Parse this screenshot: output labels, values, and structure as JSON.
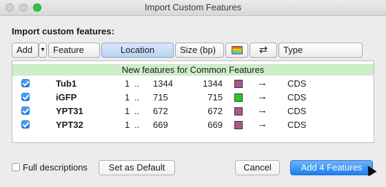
{
  "window": {
    "title": "Import Custom Features"
  },
  "section_label": "Import custom features:",
  "columns": {
    "add": "Add",
    "add_menu": "▾",
    "feature": "Feature",
    "location": "Location",
    "size": "Size (bp)",
    "direction": "⇄",
    "type": "Type"
  },
  "group_header": "New features for Common Features",
  "rows": [
    {
      "checked": true,
      "name": "Tub1",
      "start": "1",
      "dots": "..",
      "end": "1344",
      "size": "1344",
      "color": "#b0578a",
      "direction": "→",
      "type": "CDS"
    },
    {
      "checked": true,
      "name": "iGFP",
      "start": "1",
      "dots": "..",
      "end": "715",
      "size": "715",
      "color": "#22cc22",
      "direction": "→",
      "type": "CDS"
    },
    {
      "checked": true,
      "name": "YPT31",
      "start": "1",
      "dots": "..",
      "end": "672",
      "size": "672",
      "color": "#b0578a",
      "direction": "→",
      "type": "CDS"
    },
    {
      "checked": true,
      "name": "YPT32",
      "start": "1",
      "dots": "..",
      "end": "669",
      "size": "669",
      "color": "#b0578a",
      "direction": "→",
      "type": "CDS"
    }
  ],
  "footer": {
    "full_descriptions": "Full descriptions",
    "set_default": "Set as Default",
    "cancel": "Cancel",
    "add_features": "Add 4 Features"
  }
}
